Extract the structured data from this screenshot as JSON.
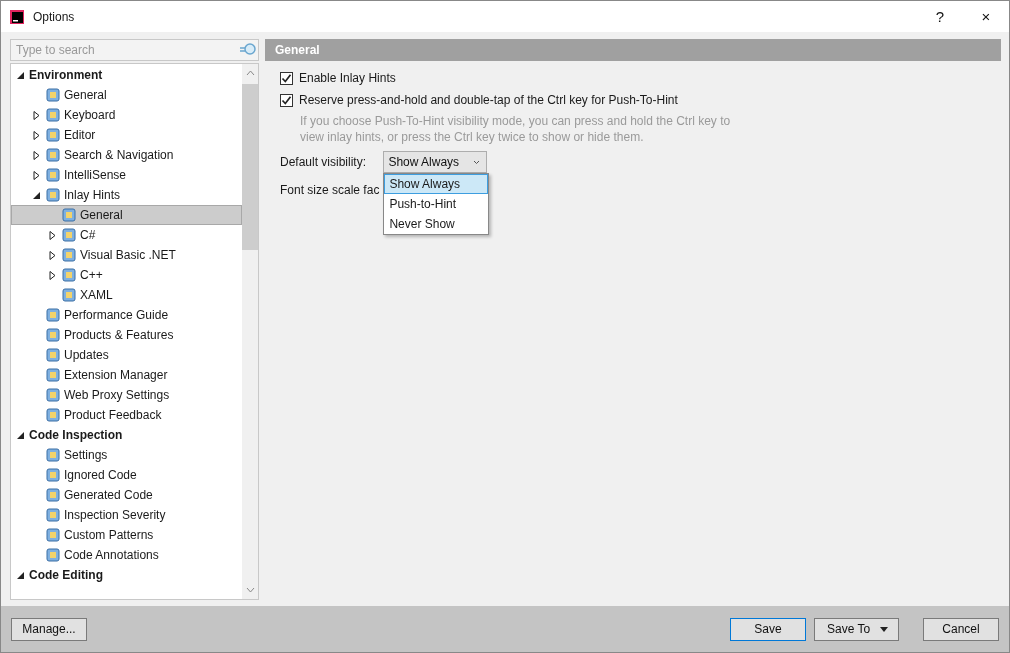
{
  "window": {
    "title": "Options",
    "help": "?",
    "close": "×"
  },
  "search": {
    "placeholder": "Type to search"
  },
  "tree": [
    {
      "label": "Environment",
      "expanded": true,
      "selected": false,
      "children": [
        {
          "label": "General",
          "selected": false
        },
        {
          "label": "Keyboard",
          "expanded": false,
          "selected": false
        },
        {
          "label": "Editor",
          "expanded": false,
          "selected": false
        },
        {
          "label": "Search & Navigation",
          "expanded": false,
          "selected": false
        },
        {
          "label": "IntelliSense",
          "expanded": false,
          "selected": false
        },
        {
          "label": "Inlay Hints",
          "expanded": true,
          "selected": false,
          "children": [
            {
              "label": "General",
              "selected": true
            },
            {
              "label": "C#",
              "expanded": false,
              "selected": false
            },
            {
              "label": "Visual Basic .NET",
              "expanded": false,
              "selected": false
            },
            {
              "label": "C++",
              "expanded": false,
              "selected": false
            },
            {
              "label": "XAML",
              "selected": false
            }
          ]
        },
        {
          "label": "Performance Guide",
          "selected": false
        },
        {
          "label": "Products & Features",
          "selected": false
        },
        {
          "label": "Updates",
          "selected": false
        },
        {
          "label": "Extension Manager",
          "selected": false
        },
        {
          "label": "Web Proxy Settings",
          "selected": false
        },
        {
          "label": "Product Feedback",
          "selected": false
        }
      ]
    },
    {
      "label": "Code Inspection",
      "expanded": true,
      "selected": false,
      "children": [
        {
          "label": "Settings",
          "selected": false
        },
        {
          "label": "Ignored Code",
          "selected": false
        },
        {
          "label": "Generated Code",
          "selected": false
        },
        {
          "label": "Inspection Severity",
          "selected": false
        },
        {
          "label": "Custom Patterns",
          "selected": false
        },
        {
          "label": "Code Annotations",
          "selected": false
        }
      ]
    },
    {
      "label": "Code Editing",
      "expanded": true,
      "selected": false
    }
  ],
  "page": {
    "title": "General",
    "checkboxes": [
      {
        "label": "Enable Inlay Hints",
        "checked": true
      },
      {
        "label": "Reserve press-and-hold and double-tap of the Ctrl key for Push-To-Hint",
        "checked": true
      }
    ],
    "hint": "If you choose Push-To-Hint visibility mode, you can press and hold the Ctrl key to view inlay hints, or press the Ctrl key twice to show or hide them.",
    "visibility": {
      "label": "Default visibility:",
      "value": "Show Always",
      "options": [
        {
          "label": "Show Always",
          "selected": true
        },
        {
          "label": "Push-to-Hint",
          "selected": false
        },
        {
          "label": "Never Show",
          "selected": false
        }
      ]
    },
    "font_scale_label": "Font size scale fac"
  },
  "buttons": {
    "manage": "Manage...",
    "save": "Save",
    "save_to": "Save To",
    "cancel": "Cancel"
  }
}
